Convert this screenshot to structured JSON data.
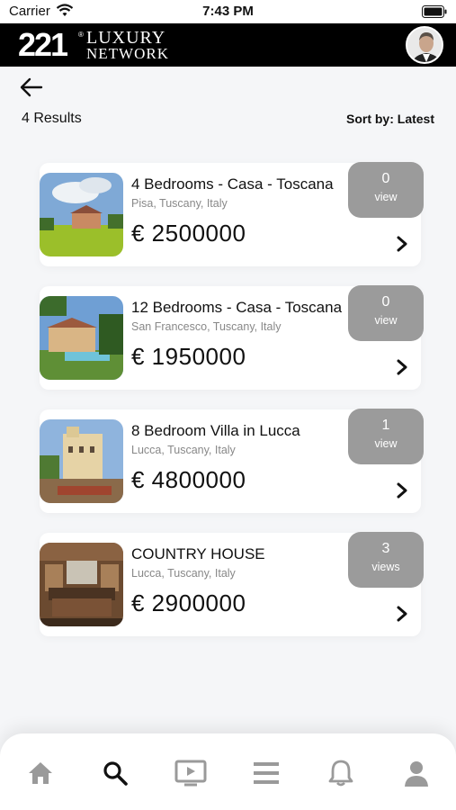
{
  "status_bar": {
    "carrier": "Carrier",
    "time": "7:43 PM"
  },
  "header": {
    "logo_number": "221",
    "logo_mark": "®",
    "logo_line1": "LUXURY",
    "logo_line2": "NETWORK",
    "avatar_icon": "user-avatar-icon"
  },
  "results": {
    "count_label": "4 Results",
    "sort_label": "Sort by: Latest"
  },
  "listings": [
    {
      "title": "4 Bedrooms - Casa - Toscana",
      "location": "Pisa, Tuscany, Italy",
      "price": "€ 2500000",
      "views_count": "0",
      "views_label": "view"
    },
    {
      "title": "12 Bedrooms - Casa - Toscana",
      "location": "San Francesco, Tuscany, Italy",
      "price": "€ 1950000",
      "views_count": "0",
      "views_label": "view"
    },
    {
      "title": "8 Bedroom Villa in Lucca",
      "location": "Lucca, Tuscany, Italy",
      "price": "€ 4800000",
      "views_count": "1",
      "views_label": "view"
    },
    {
      "title": "COUNTRY HOUSE",
      "location": "Lucca, Tuscany, Italy",
      "price": "€ 2900000",
      "views_count": "3",
      "views_label": "views"
    }
  ],
  "bottom_nav": [
    "home-icon",
    "search-icon",
    "video-icon",
    "menu-icon",
    "bell-icon",
    "profile-icon"
  ],
  "colors": {
    "header_bg": "#000000",
    "badge_bg": "#9b9b9b",
    "page_bg": "#f5f6f8",
    "nav_icon": "#9a9a9a",
    "nav_active": "#111111"
  }
}
